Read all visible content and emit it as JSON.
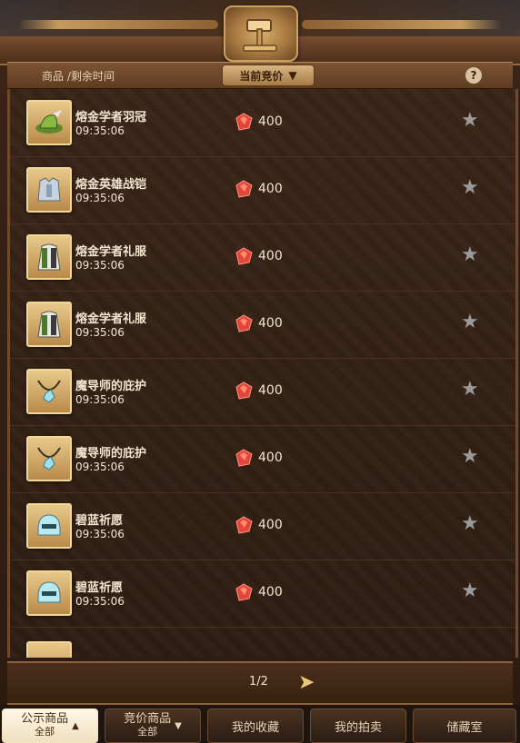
{
  "header": {
    "column_label": "商品 /剩余时间",
    "sort_label": "当前竞价",
    "sort_caret": "▼",
    "help_label": "?"
  },
  "items": [
    {
      "name": "熔金学者羽冠",
      "time": "09:35:06",
      "price": "400",
      "icon": "hat-icon"
    },
    {
      "name": "熔金英雄战铠",
      "time": "09:35:06",
      "price": "400",
      "icon": "armor-icon"
    },
    {
      "name": "熔金学者礼服",
      "time": "09:35:06",
      "price": "400",
      "icon": "robe-icon"
    },
    {
      "name": "熔金学者礼服",
      "time": "09:35:06",
      "price": "400",
      "icon": "robe-icon"
    },
    {
      "name": "魔导师的庇护",
      "time": "09:35:06",
      "price": "400",
      "icon": "amulet-icon"
    },
    {
      "name": "魔导师的庇护",
      "time": "09:35:06",
      "price": "400",
      "icon": "amulet-icon"
    },
    {
      "name": "碧蓝祈愿",
      "time": "09:35:06",
      "price": "400",
      "icon": "helmet-icon"
    },
    {
      "name": "碧蓝祈愿",
      "time": "09:35:06",
      "price": "400",
      "icon": "helmet-icon"
    }
  ],
  "pager": {
    "page_text": "1/2"
  },
  "tabs": [
    {
      "label": "公示商品",
      "sub": "全部",
      "active": true
    },
    {
      "label": "竞价商品",
      "sub": "全部",
      "active": false
    },
    {
      "label": "我的收藏",
      "sub": "",
      "active": false
    },
    {
      "label": "我的拍卖",
      "sub": "",
      "active": false
    },
    {
      "label": "储藏室",
      "sub": "",
      "active": false
    }
  ],
  "colors": {
    "gem": "#e2453a",
    "star": "#9a9a9a",
    "accent_gold": "#e8c97a"
  }
}
